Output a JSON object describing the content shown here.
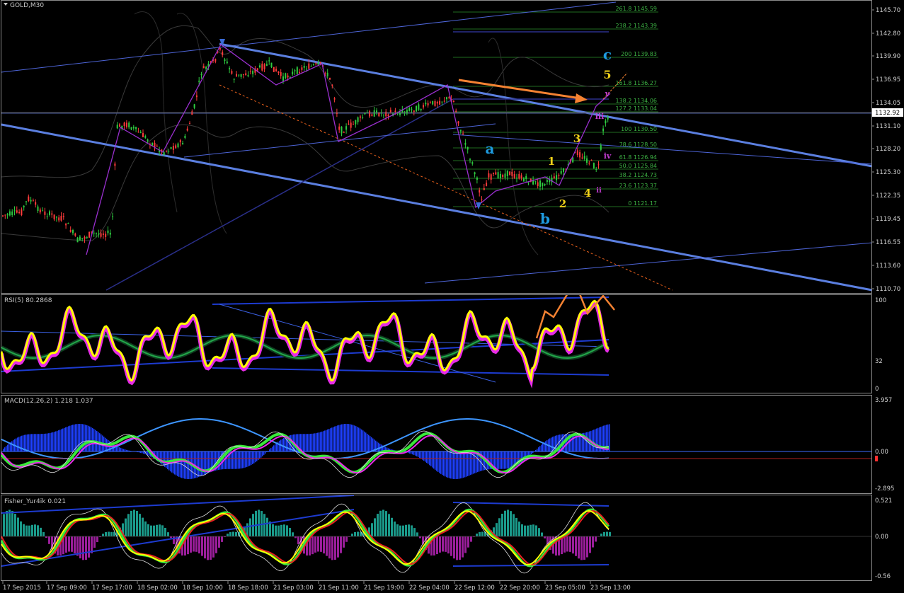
{
  "panels": {
    "main": {
      "title": "GOLD,M30",
      "current_price": "1132.92",
      "price_ticks": [
        "1145.70",
        "1142.80",
        "1139.90",
        "1136.95",
        "1134.05",
        "1131.10",
        "1128.20",
        "1125.30",
        "1122.35",
        "1119.45",
        "1116.55",
        "1113.60",
        "1110.70"
      ]
    },
    "rsi": {
      "title": "RSI(5) 80.2868",
      "ticks": [
        "100",
        "32",
        "0"
      ]
    },
    "macd": {
      "title": "MACD(12,26,2) 1.218 1.037",
      "ticks": [
        "3.957",
        "0.00",
        "-2.895"
      ]
    },
    "fisher": {
      "title": "Fisher_Yur4ik 0.021",
      "ticks": [
        "0.521",
        "0.00",
        "-0.56"
      ]
    }
  },
  "fib_levels": [
    {
      "label": "261.8 1145.59"
    },
    {
      "label": "238.2 1143.39"
    },
    {
      "label": "200 1139.83"
    },
    {
      "label": "161.8 1136.27"
    },
    {
      "label": "138.2 1134.06"
    },
    {
      "label": "127.2 1133.04"
    },
    {
      "label": "100 1130.50"
    },
    {
      "label": "78.6 1128.50"
    },
    {
      "label": "61.8 1126.94"
    },
    {
      "label": "50.0 1125.84"
    },
    {
      "label": "38.2 1124.73"
    },
    {
      "label": "23.6 1123.37"
    },
    {
      "label": "0 1121.17"
    }
  ],
  "waves": [
    {
      "text": "c",
      "color": "#1e9be0"
    },
    {
      "text": "5",
      "color": "#f2d31a"
    },
    {
      "text": "v",
      "color": "#c23cd0"
    },
    {
      "text": "iii",
      "color": "#c23cd0"
    },
    {
      "text": "3",
      "color": "#f2d31a"
    },
    {
      "text": "a",
      "color": "#1e9be0"
    },
    {
      "text": "iv",
      "color": "#c23cd0"
    },
    {
      "text": "1",
      "color": "#f2d31a"
    },
    {
      "text": "4",
      "color": "#f2d31a"
    },
    {
      "text": "ii",
      "color": "#c23cd0"
    },
    {
      "text": "2",
      "color": "#f2d31a"
    },
    {
      "text": "b",
      "color": "#1e9be0"
    }
  ],
  "time_labels": [
    "17 Sep 2015",
    "17 Sep 09:00",
    "17 Sep 17:00",
    "18 Sep 02:00",
    "18 Sep 10:00",
    "18 Sep 18:00",
    "21 Sep 03:00",
    "21 Sep 11:00",
    "21 Sep 19:00",
    "22 Sep 04:00",
    "22 Sep 12:00",
    "22 Sep 20:00",
    "23 Sep 05:00",
    "23 Sep 13:00"
  ],
  "colors": {
    "candle_up": "#2ecc40",
    "candle_down": "#ff3b3b",
    "trend": "#5b7fe0",
    "rsi": "#ffff00",
    "macd_hist": "#1e40ff",
    "fisher_pos": "#1a9a8a",
    "fisher_neg": "#9a1e9a"
  }
}
